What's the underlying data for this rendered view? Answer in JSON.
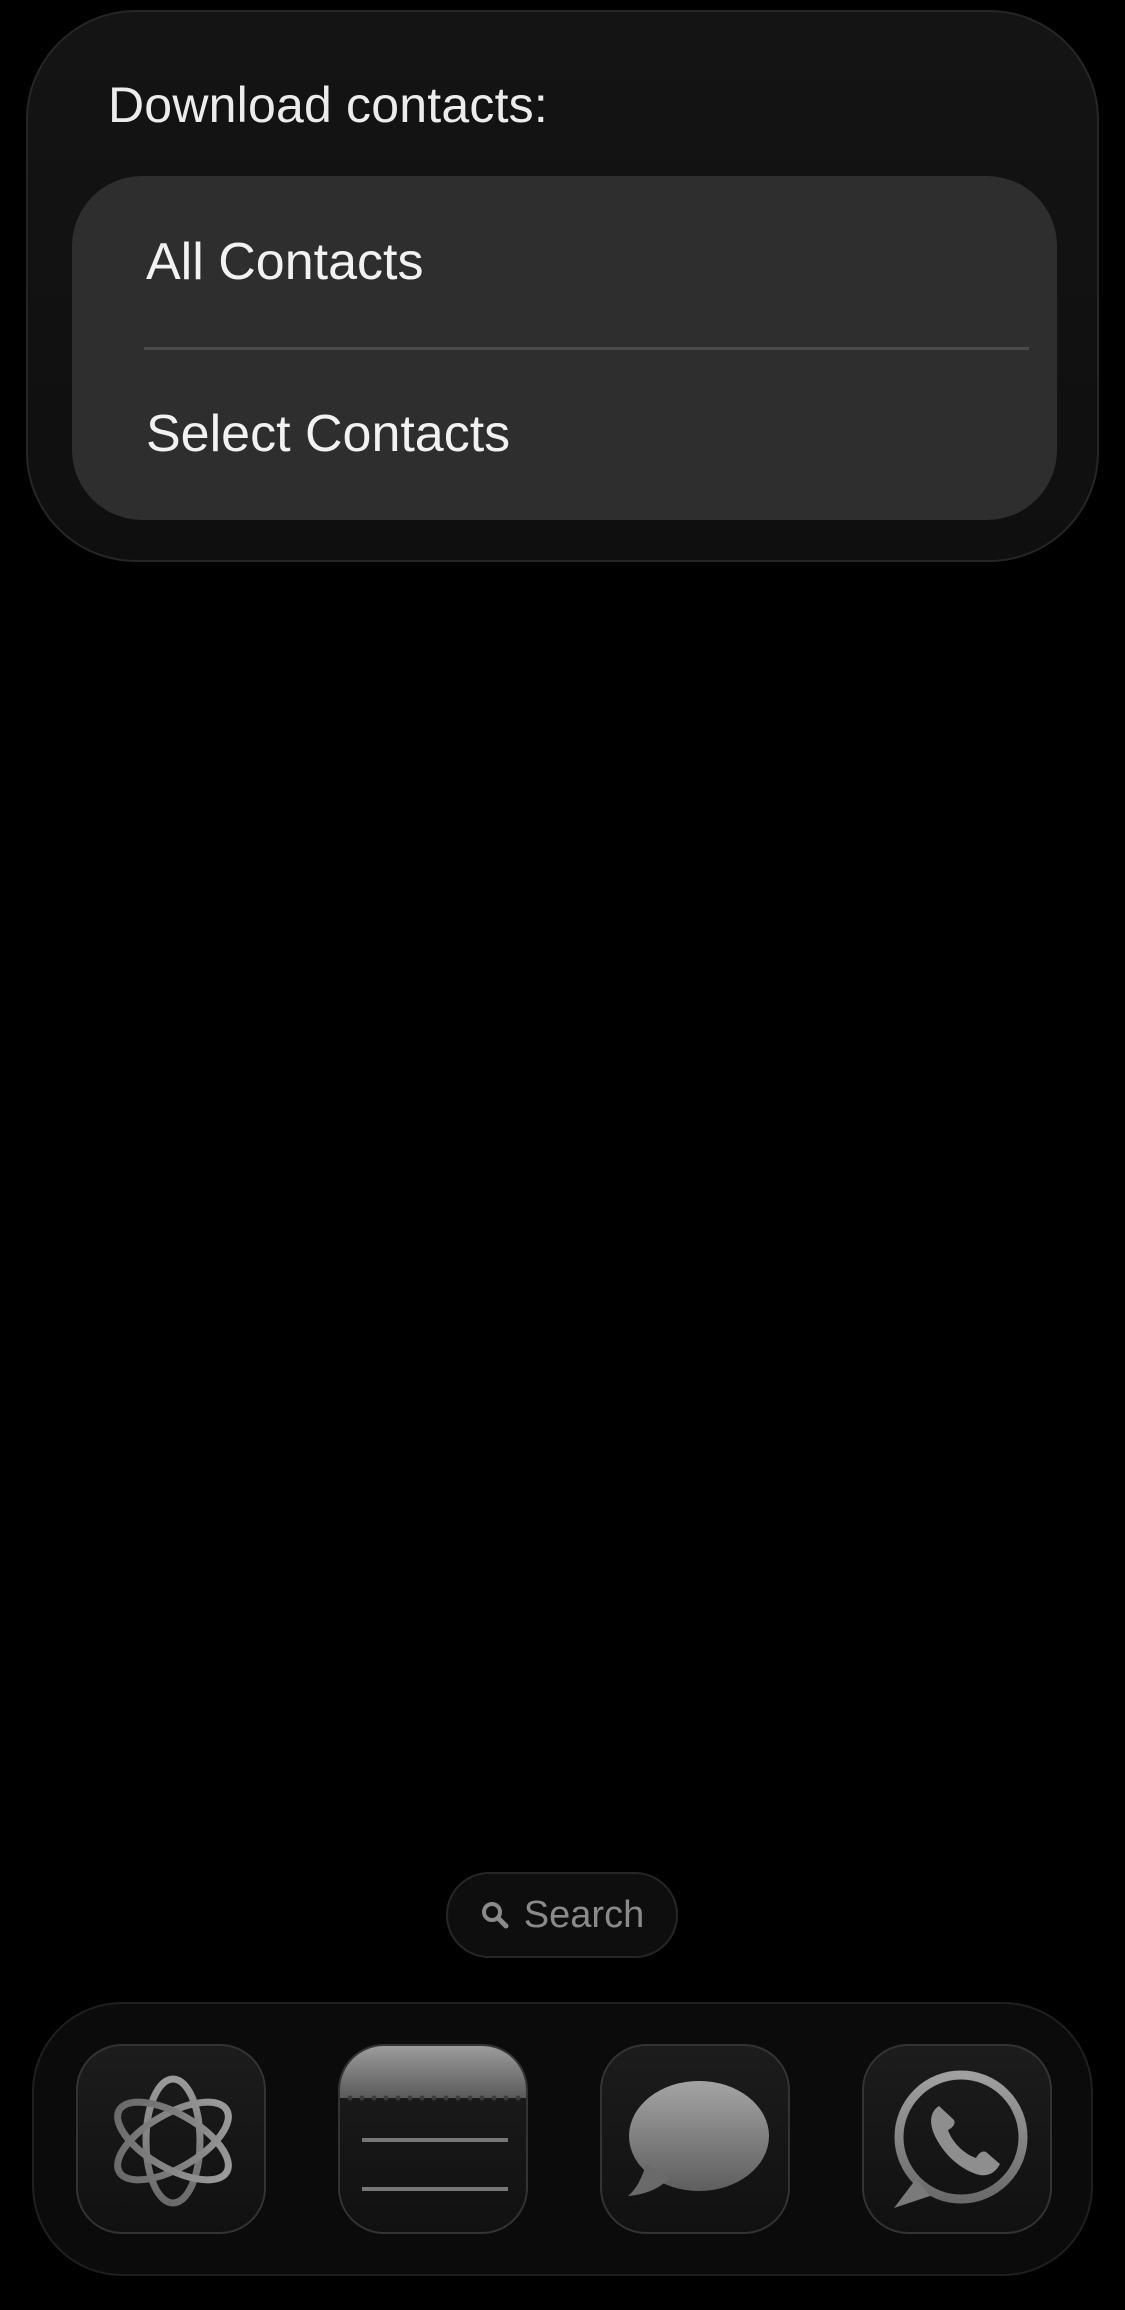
{
  "menu": {
    "title": "Download contacts:",
    "options": [
      {
        "label": "All Contacts"
      },
      {
        "label": "Select Contacts"
      }
    ]
  },
  "search": {
    "label": "Search",
    "icon": "magnifying-glass-icon"
  },
  "dock": {
    "apps": [
      {
        "name": "ChatGPT",
        "icon": "chatgpt-knot-icon"
      },
      {
        "name": "Notes",
        "icon": "notes-icon"
      },
      {
        "name": "Messages",
        "icon": "speech-bubble-icon"
      },
      {
        "name": "WhatsApp",
        "icon": "whatsapp-phone-icon"
      }
    ]
  },
  "colors": {
    "background": "#000000",
    "card": "#121212",
    "panel": "#2e2e2e",
    "text": "#f2f2f2",
    "muted": "#8a8a8a"
  }
}
